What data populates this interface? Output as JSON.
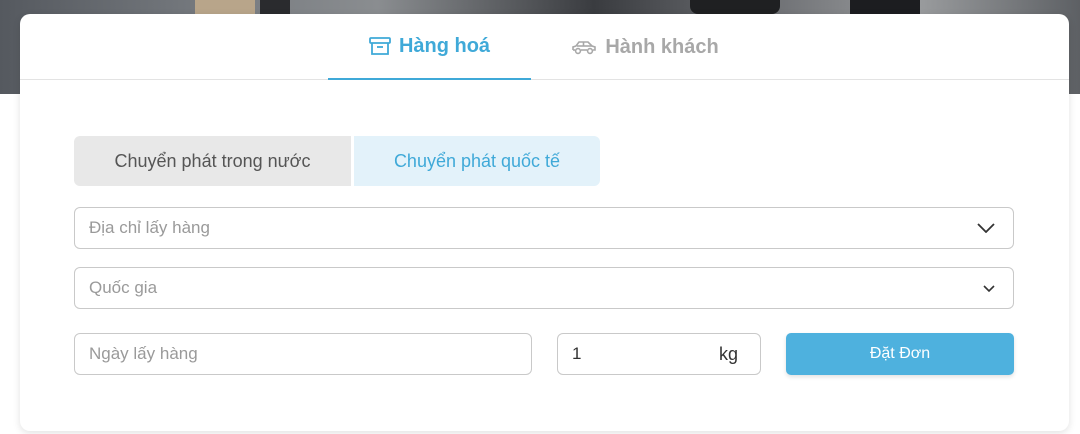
{
  "tabs": {
    "goods": {
      "label": "Hàng hoá",
      "icon": "box-icon"
    },
    "passenger": {
      "label": "Hành khách",
      "icon": "car-icon"
    }
  },
  "segments": {
    "domestic": "Chuyển phát trong nước",
    "international": "Chuyển phát quốc tế"
  },
  "form": {
    "pickup_address_placeholder": "Địa chỉ lấy hàng",
    "country_placeholder": "Quốc gia",
    "pickup_date_placeholder": "Ngày lấy hàng",
    "weight_value": "1",
    "weight_unit": "kg",
    "submit_label": "Đặt Đơn"
  },
  "colors": {
    "accent": "#3fa9d8",
    "button": "#4eb1de",
    "inactive_tab": "#a8a8a8"
  }
}
